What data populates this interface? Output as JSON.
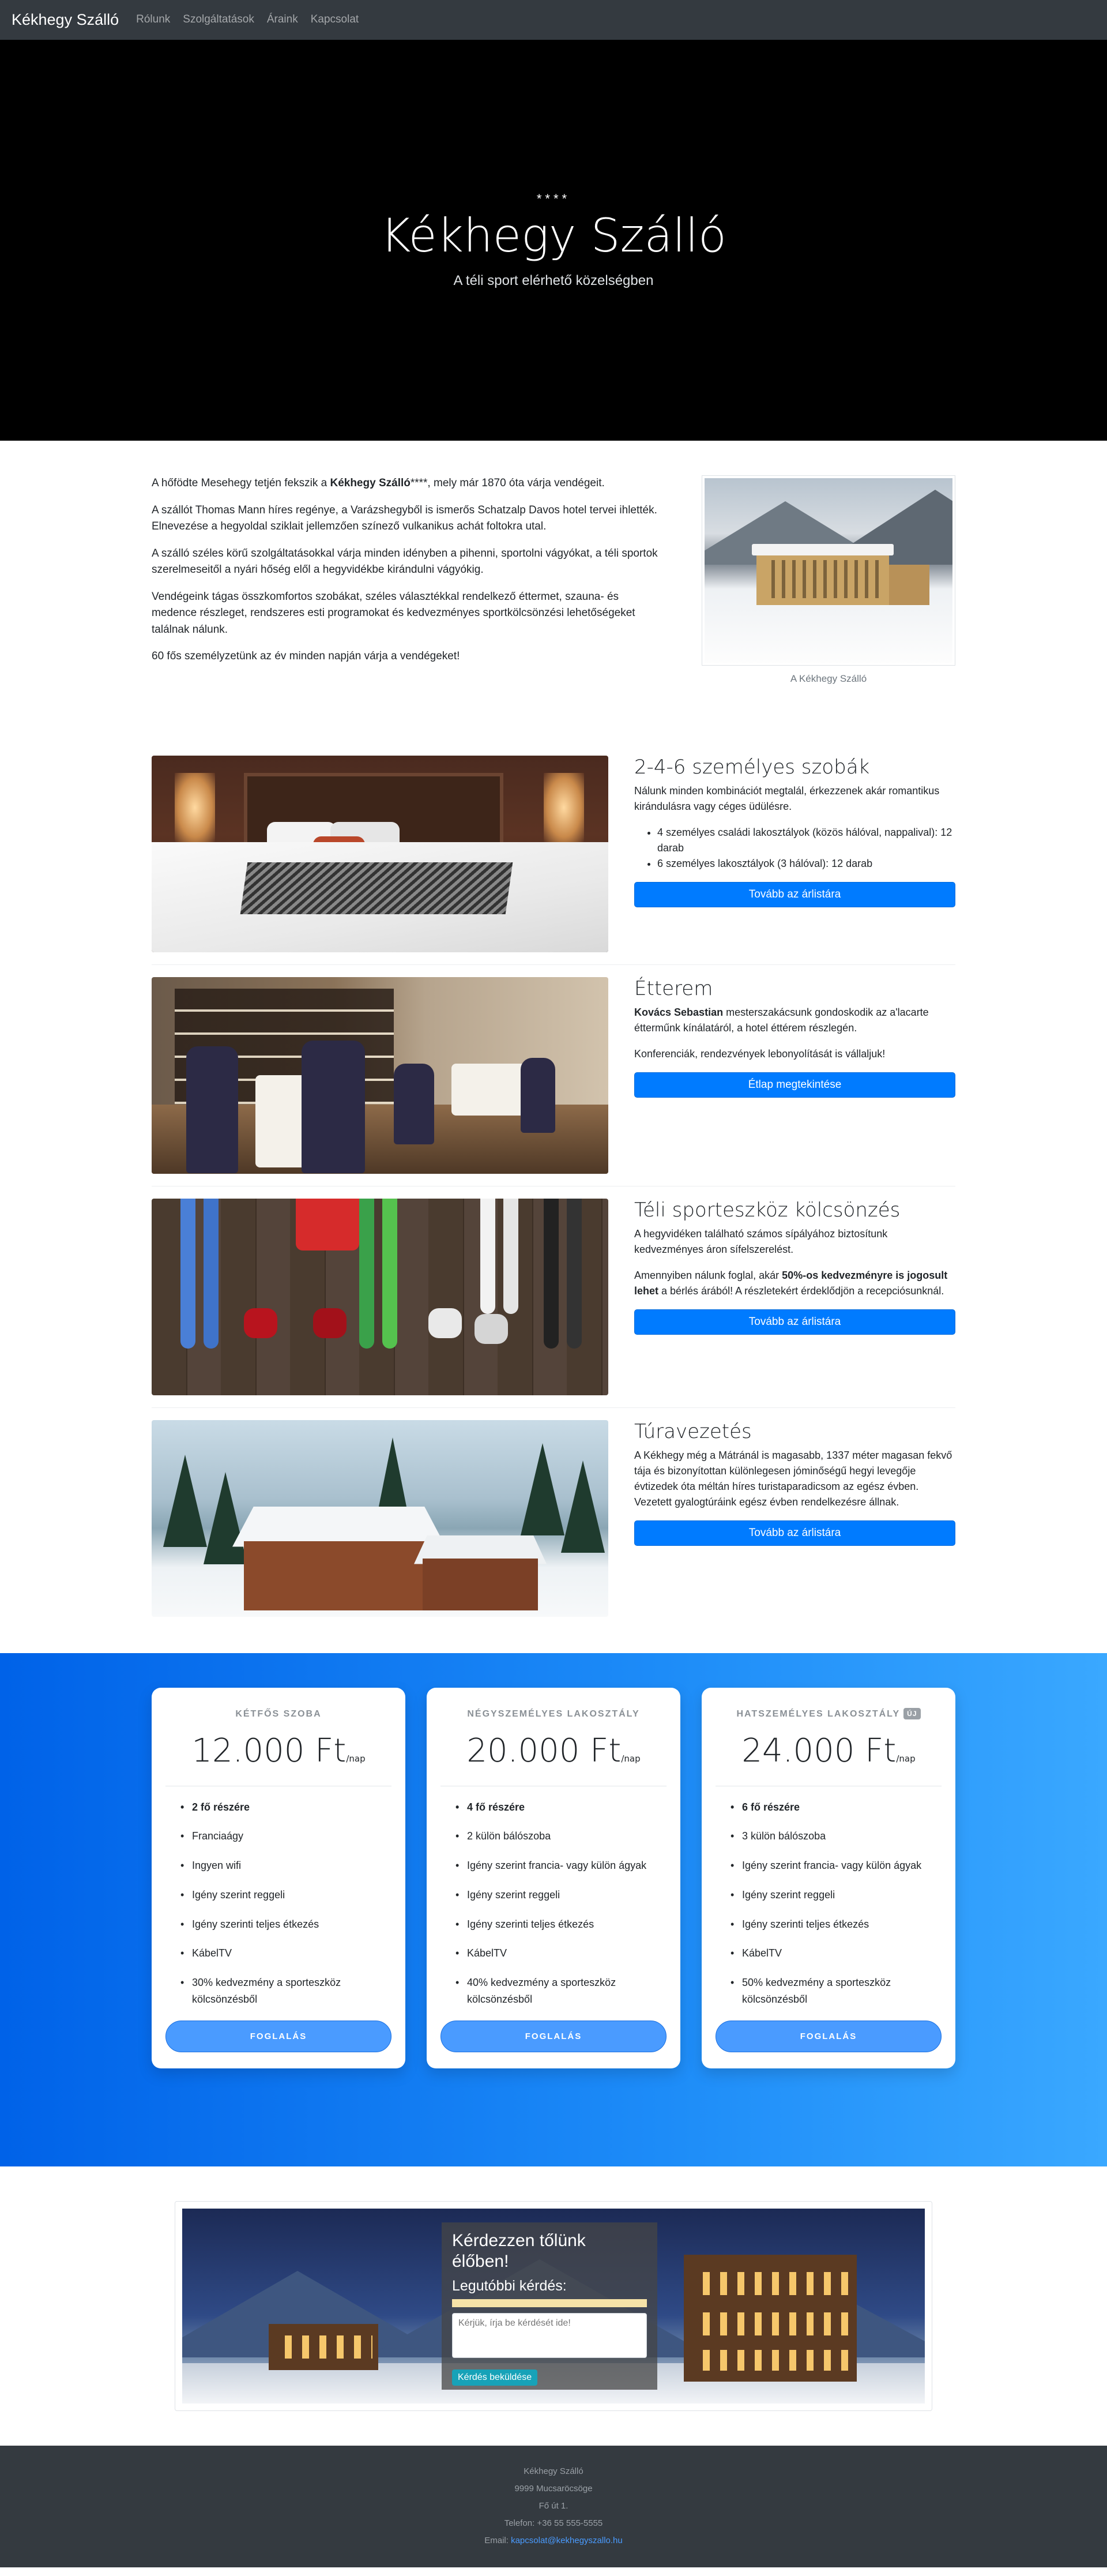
{
  "nav": {
    "brand": "Kékhegy Szálló",
    "links": [
      "Rólunk",
      "Szolgáltatások",
      "Áraink",
      "Kapcsolat"
    ]
  },
  "hero": {
    "stars": "****",
    "title": "Kékhegy Szálló",
    "subtitle": "A téli sport elérhető közelségben"
  },
  "about": {
    "p1_pre": "A hőfödte Mesehegy tetjén fekszik a ",
    "p1_strong": "Kékhegy Szálló",
    "p1_post": "****, mely már 1870 óta várja vendégeit.",
    "p2": "A szállót Thomas Mann híres regénye, a Varázshegyből is ismerős Schatzalp Davos hotel tervei ihlették. Elnevezése a hegyoldal sziklait jellemzően színező vulkanikus achát foltokra utal.",
    "p3": "A szálló széles körű szolgáltatásokkal várja minden idényben a pihenni, sportolni vágyókat, a téli sportok szerelmeseitől a nyári hőség elől a hegyvidékbe kirándulni vágyókig.",
    "p4": "Vendégeink tágas összkomfortos szobákat, széles választékkal rendelkező éttermet, szauna- és medence részleget, rendszeres esti programokat és kedvezményes sportkölcsönzési lehetőségeket találnak nálunk.",
    "p5": "60 fős személyzetünk az év minden napján várja a vendégeket!",
    "caption": "A Kékhegy Szálló"
  },
  "features": {
    "rooms": {
      "title": "2-4-6 személyes szobák",
      "text": "Nálunk minden kombinációt megtalál, érkezzenek akár romantikus kirándulásra vagy céges üdülésre.",
      "items": [
        "4 személyes családi lakosztályok (közös hálóval, nappalival): 12 darab",
        "6 személyes lakosztályok (3 hálóval): 12 darab"
      ],
      "button": "Tovább az árlistára"
    },
    "restaurant": {
      "title": "Étterem",
      "chef": "Kovács Sebastian",
      "text": " mesterszakácsunk gondoskodik az a'lacarte étterműnk kínálatáról, a hotel éttérem részlegén.",
      "text2": "Konferenciák, rendezvények lebonyolítását is vállaljuk!",
      "button": "Étlap megtekintése"
    },
    "rental": {
      "title": "Téli sporteszköz kölcsönzés",
      "text": "A hegyvidéken található számos sípályához biztosítunk kedvezményes áron sífelszerelést.",
      "t2_pre": "Amennyiben nálunk foglal, akár ",
      "t2_strong": "50%-os kedvezményre is jogosult lehet",
      "t2_post": " a bérlés árából! A részletekért érdeklődjön a recepciósunknál.",
      "button": "Tovább az árlistára"
    },
    "tours": {
      "title": "Túravezetés",
      "text": "A Kékhegy még a Mátránál is magasabb, 1337 méter magasan fekvő tája és bizonyítottan különlegesen jóminőségű hegyi levegője évtizedek óta méltán híres turistaparadicsom az egész évben. Vezetett gyalogtúráink egész évben rendelkezésre állnak.",
      "button": "Tovább az árlistára"
    }
  },
  "pricing": {
    "per": "/nap",
    "book": "FOGLALÁS",
    "cards": [
      {
        "name": "KÉTFŐS SZOBA",
        "price": "12.000 Ft",
        "lead": "2 fő részére",
        "items": [
          "Franciaágy",
          "Ingyen wifi",
          "Igény szerint reggeli",
          "Igény szerinti teljes étkezés",
          "KábelTV",
          "30% kedvezmény a sporteszköz kölcsönzésből"
        ]
      },
      {
        "name": "NÉGYSZEMÉLYES LAKOSZTÁLY",
        "price": "20.000 Ft",
        "lead": "4 fő részére",
        "items": [
          "2 külön bálószoba",
          "Igény szerint francia- vagy külön ágyak",
          "Igény szerint reggeli",
          "Igény szerinti teljes étkezés",
          "KábelTV",
          "40% kedvezmény a sporteszköz kölcsönzésből"
        ]
      },
      {
        "name": "HATSZEMÉLYES LAKOSZTÁLY",
        "badge": "ÚJ",
        "price": "24.000 Ft",
        "lead": "6 fő részére",
        "items": [
          "3 külön bálószoba",
          "Igény szerint francia- vagy külön ágyak",
          "Igény szerint reggeli",
          "Igény szerinti teljes étkezés",
          "KábelTV",
          "50% kedvezmény a sporteszköz kölcsönzésből"
        ]
      }
    ]
  },
  "contact": {
    "title": "Kérdezzen tőlünk élőben!",
    "subtitle": "Legutóbbi kérdés:",
    "placeholder": "Kérjük, írja be kérdését ide!",
    "button": "Kérdés beküldése"
  },
  "footer": {
    "name": "Kékhegy Szálló",
    "city": "9999 Mucsaröcsöge",
    "street": "Fő út 1.",
    "phone": "Telefon: +36 55 555-5555",
    "email_label": "Email: ",
    "email": "kapcsolat@kekhegyszallo.hu"
  },
  "colors": {
    "primary": "#007bff",
    "nav_bg": "#343a40",
    "pricing_from": "#0062e8",
    "pricing_to": "#3aa8ff"
  }
}
